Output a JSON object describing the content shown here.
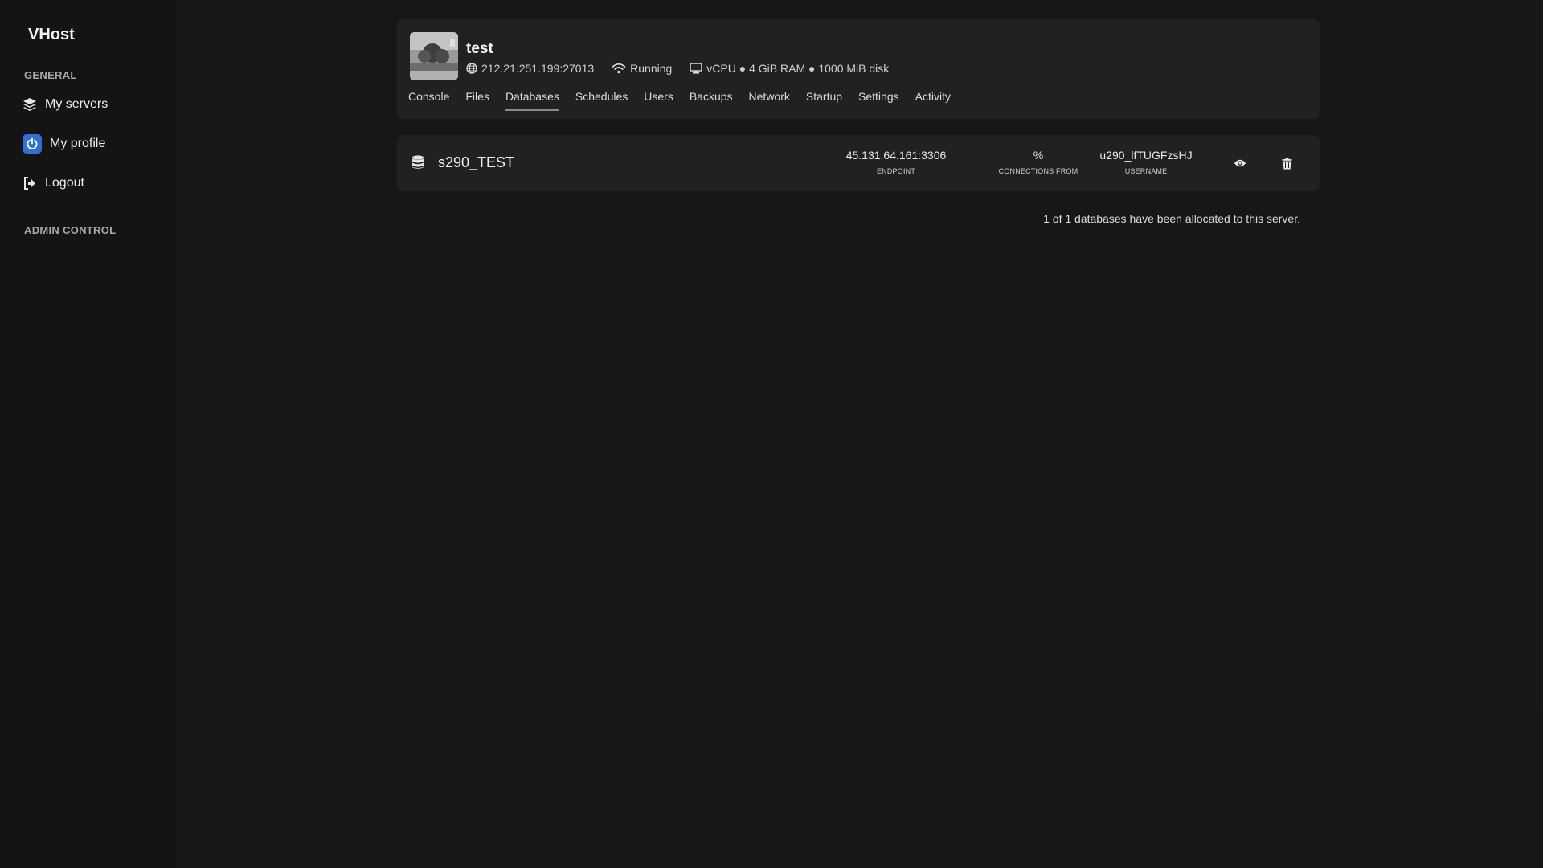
{
  "sidebar": {
    "brand": "VHost",
    "general_title": "GENERAL",
    "items": [
      {
        "label": "My servers",
        "icon": "layers-icon"
      },
      {
        "label": "My profile",
        "icon": "power-icon"
      },
      {
        "label": "Logout",
        "icon": "logout-icon"
      }
    ],
    "admin_title": "ADMIN CONTROL"
  },
  "server": {
    "name": "test",
    "address": "212.21.251.199:27013",
    "status": "Running",
    "resources": "vCPU ● 4 GiB RAM ● 1000 MiB disk",
    "tabs": [
      "Console",
      "Files",
      "Databases",
      "Schedules",
      "Users",
      "Backups",
      "Network",
      "Startup",
      "Settings",
      "Activity"
    ],
    "active_tab": "Databases"
  },
  "databases": [
    {
      "name": "s290_TEST",
      "endpoint": "45.131.64.161:3306",
      "endpoint_label": "ENDPOINT",
      "connections_from": "%",
      "connections_label": "CONNECTIONS FROM",
      "username": "u290_lfTUGFzsHJ",
      "username_label": "USERNAME"
    }
  ],
  "footer_note": "1 of 1 databases have been allocated to this server.",
  "colors": {
    "background": "#171717",
    "sidebar": "#141414",
    "card": "#212121",
    "accent_profile": "#2f6fd6"
  }
}
